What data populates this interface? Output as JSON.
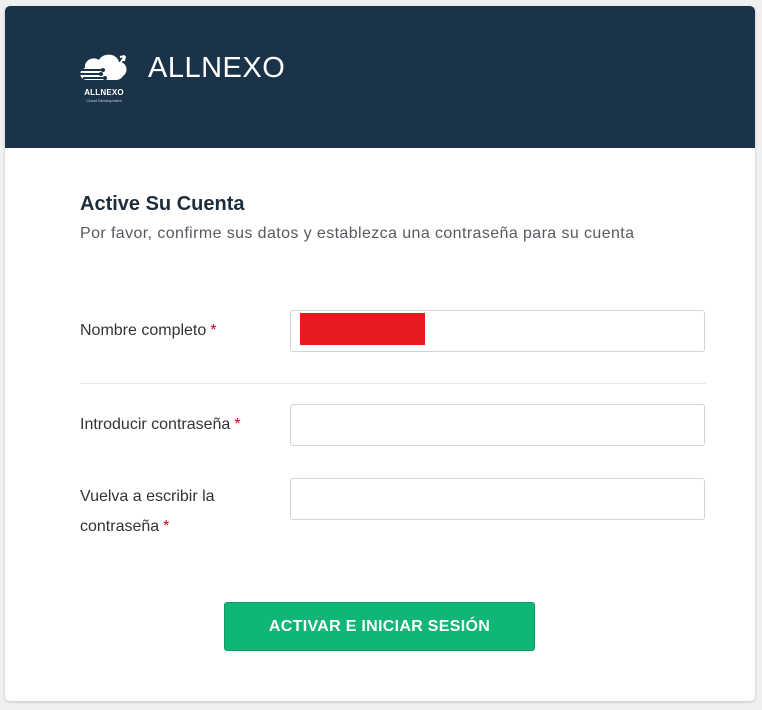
{
  "header": {
    "brand": "ALLNEXO",
    "logo_caption": "ALLNEXO",
    "logo_subcaption": "Cloud Development",
    "background": "#1b3349"
  },
  "form": {
    "title": "Active Su Cuenta",
    "subtitle": "Por favor, confirme sus datos y establezca una contraseña para su cuenta",
    "required_marker": "*",
    "fields": [
      {
        "label": "Nombre completo",
        "value": "",
        "redacted": true
      },
      {
        "label": "Introducir contraseña",
        "value": ""
      },
      {
        "label_line1": "Vuelva a escribir la",
        "label_line2": "contraseña",
        "value": ""
      }
    ],
    "submit_label": "ACTIVAR E INICIAR SESIÓN",
    "accent": "#0fb676",
    "required_color": "#d0021b"
  }
}
